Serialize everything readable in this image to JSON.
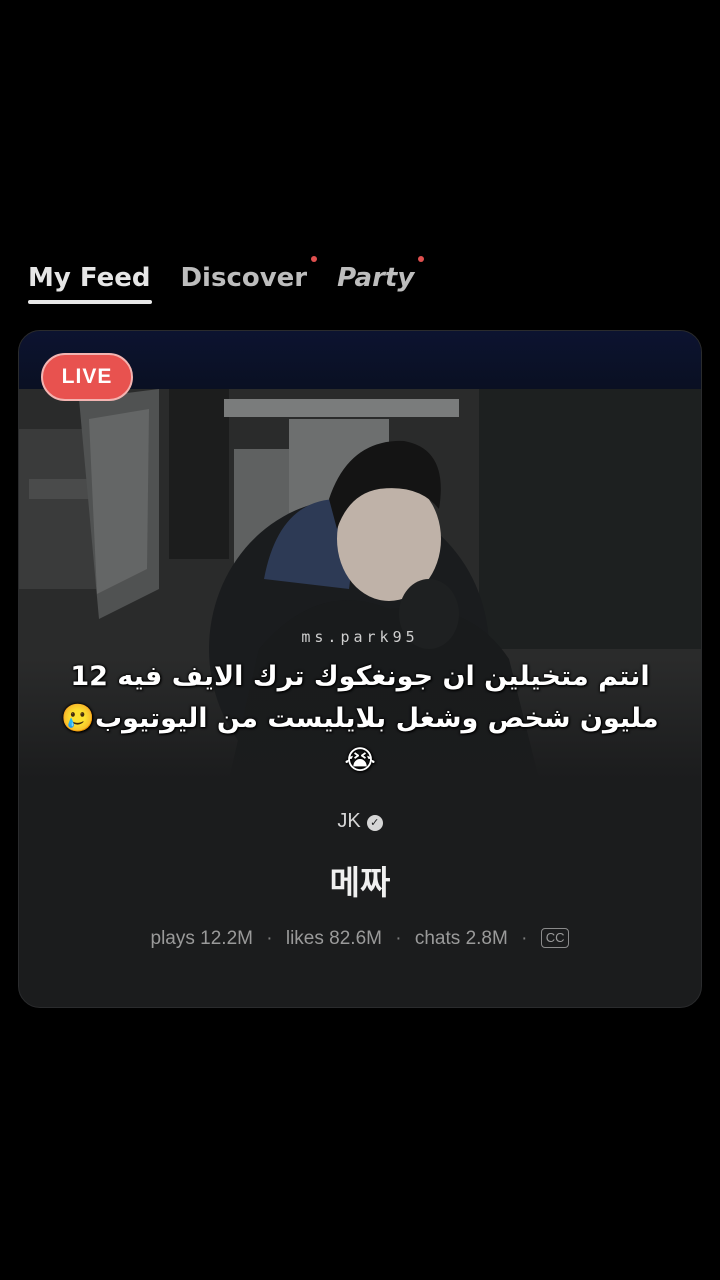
{
  "tabs": [
    {
      "label": "My Feed",
      "active": true,
      "dot": false
    },
    {
      "label": "Discover",
      "active": false,
      "dot": true
    },
    {
      "label": "Party",
      "active": false,
      "dot": true
    }
  ],
  "card": {
    "live_label": "LIVE",
    "watermark": "ms.park95",
    "overlay_text": "انتم متخيلين ان جونغكوك ترك الايف فيه 12 مليون شخص وشغل بلايليست من اليوتيوب🥲😭",
    "author": "JK",
    "title": "메짜",
    "stats": {
      "plays_label": "plays",
      "plays_value": "12.2M",
      "likes_label": "likes",
      "likes_value": "82.6M",
      "chats_label": "chats",
      "chats_value": "2.8M",
      "cc_label": "CC"
    }
  },
  "colors": {
    "background": "#000000",
    "live_badge": "#e8524f",
    "tab_dot": "#e0504f"
  }
}
